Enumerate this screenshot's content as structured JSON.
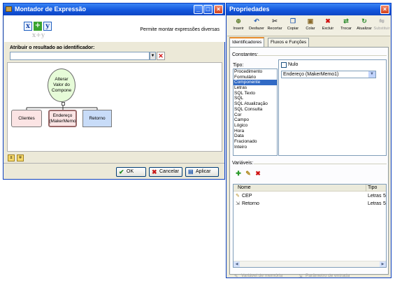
{
  "left_window": {
    "title": "Montador de Expressão",
    "header_description": "Permite montar expressões diversas",
    "logo": {
      "x": "x",
      "plus": "+",
      "y": "y"
    },
    "assign_label": "Atribuir o resultado ao identificador:",
    "assign_value": "",
    "diagram": {
      "root": {
        "lines": [
          "Alterar",
          "Valor do",
          "Compone"
        ]
      },
      "children": [
        {
          "lines": [
            "Clientes"
          ]
        },
        {
          "lines": [
            "Endereço",
            "(MakerMemo"
          ]
        },
        {
          "lines": [
            "Retorno"
          ]
        }
      ]
    },
    "buttons": {
      "ok": "OK",
      "cancel": "Cancelar",
      "apply": "Aplicar"
    }
  },
  "right_window": {
    "title": "Propriedades",
    "toolbar": [
      {
        "label": "Inserir",
        "icon": "insert-icon"
      },
      {
        "label": "Desfazer",
        "icon": "undo-icon"
      },
      {
        "label": "Recortar",
        "icon": "cut-icon"
      },
      {
        "label": "Copiar",
        "icon": "copy-icon"
      },
      {
        "label": "Colar",
        "icon": "paste-icon"
      },
      {
        "label": "Excluir",
        "icon": "delete-icon"
      },
      {
        "label": "Trocar",
        "icon": "swap-icon"
      },
      {
        "label": "Atualizar",
        "icon": "refresh-icon"
      },
      {
        "label": "Substituir",
        "icon": "replace-icon",
        "disabled": true
      }
    ],
    "tabs": [
      "Identificadores",
      "Fluxos e Funções"
    ],
    "constantes_label": "Constantes:",
    "tipo_label": "Tipo:",
    "tipo_items": [
      "Procedimento",
      "Formulário",
      "Componente",
      "Letras",
      "SQL Texto",
      "SQL",
      "SQL Atualização",
      "SQL Consulta",
      "Cor",
      "Campo",
      "Lógico",
      "Hora",
      "Data",
      "Fracionado",
      "Inteiro"
    ],
    "tipo_selected": "Componente",
    "nulo_label": "Nulo",
    "componente_value": "Endereço (MakerMemo1)",
    "variaveis_label": "Variáveis:",
    "var_columns": {
      "nome": "Nome",
      "tipo": "Tipo",
      "extra": ""
    },
    "var_rows": [
      {
        "nome": "CEP",
        "tipo": "Letras",
        "extra": "5"
      },
      {
        "nome": "Retorno",
        "tipo": "Letras",
        "extra": "5"
      }
    ],
    "legend": {
      "memory_var": "Variável de memória",
      "input_param": "Parâmetro de entrada"
    }
  }
}
